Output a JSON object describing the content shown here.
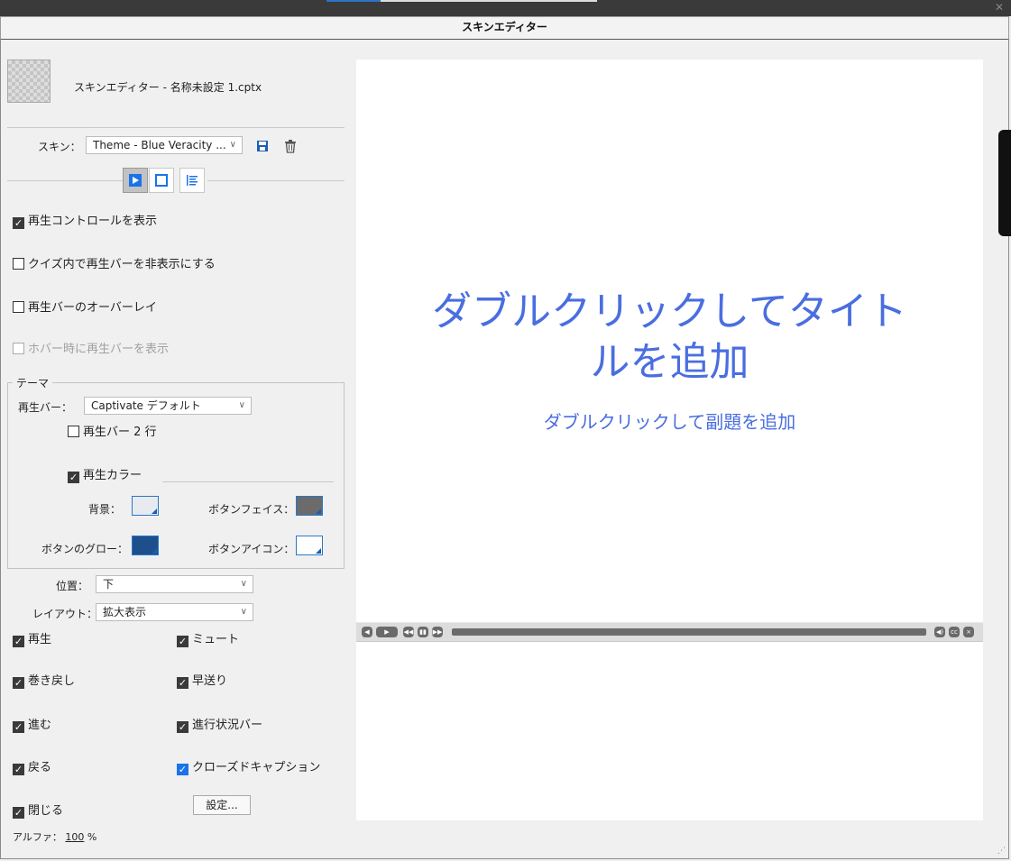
{
  "window": {
    "title": "スキンエディター"
  },
  "header": {
    "project_name": "スキンエディター - 名称未設定 1.cptx"
  },
  "skin": {
    "label": "スキン：",
    "value": "Theme - Blue Veracity ..."
  },
  "mode_tabs": [
    {
      "name": "playbar-tab",
      "icon": "play-icon",
      "active": true
    },
    {
      "name": "borders-tab",
      "icon": "square-outline-icon",
      "active": false
    },
    {
      "name": "toc-tab",
      "icon": "toc-list-icon",
      "active": false
    }
  ],
  "options": {
    "show_controls": {
      "label": "再生コントロールを表示",
      "checked": true
    },
    "hide_in_quiz": {
      "label": "クイズ内で再生バーを非表示にする",
      "checked": false
    },
    "overlay": {
      "label": "再生バーのオーバーレイ",
      "checked": false
    },
    "show_on_hover": {
      "label": "ホバー時に再生バーを表示",
      "checked": false,
      "disabled": true
    }
  },
  "theme": {
    "legend": "テーマ",
    "playbar_label": "再生バー：",
    "playbar_value": "Captivate デフォルト",
    "two_rows": {
      "label": "再生バー 2 行",
      "checked": false
    },
    "playbar_color": {
      "label": "再生カラー",
      "checked": true
    },
    "bg_label": "背景：",
    "bg_color": "#e7eaee",
    "button_face_label": "ボタンフェイス：",
    "button_face_color": "#6b6b6b",
    "button_glow_label": "ボタンのグロー：",
    "button_glow_color": "#1d4f8c",
    "button_icon_label": "ボタンアイコン：",
    "button_icon_color": "#ffffff"
  },
  "position": {
    "label": "位置：",
    "value": "下"
  },
  "layout": {
    "label": "レイアウト：",
    "value": "拡大表示"
  },
  "controls": {
    "play": {
      "label": "再生",
      "checked": true
    },
    "mute": {
      "label": "ミュート",
      "checked": true
    },
    "rewind": {
      "label": "巻き戻し",
      "checked": true
    },
    "fast_forward": {
      "label": "早送り",
      "checked": true
    },
    "forward": {
      "label": "進む",
      "checked": true
    },
    "progress_bar": {
      "label": "進行状況バー",
      "checked": true
    },
    "back": {
      "label": "戻る",
      "checked": true
    },
    "closed_caption": {
      "label": "クローズドキャプション",
      "checked": true
    },
    "close": {
      "label": "閉じる",
      "checked": true
    }
  },
  "settings_button": "設定...",
  "alpha": {
    "label": "アルファ：",
    "value": "100",
    "unit": "%"
  },
  "preview": {
    "title": "ダブルクリックしてタイトルを追加",
    "title_line1": "ダブルクリックしてタイト",
    "title_line2": "ルを追加",
    "subtitle": "ダブルクリックして副題を追加"
  }
}
